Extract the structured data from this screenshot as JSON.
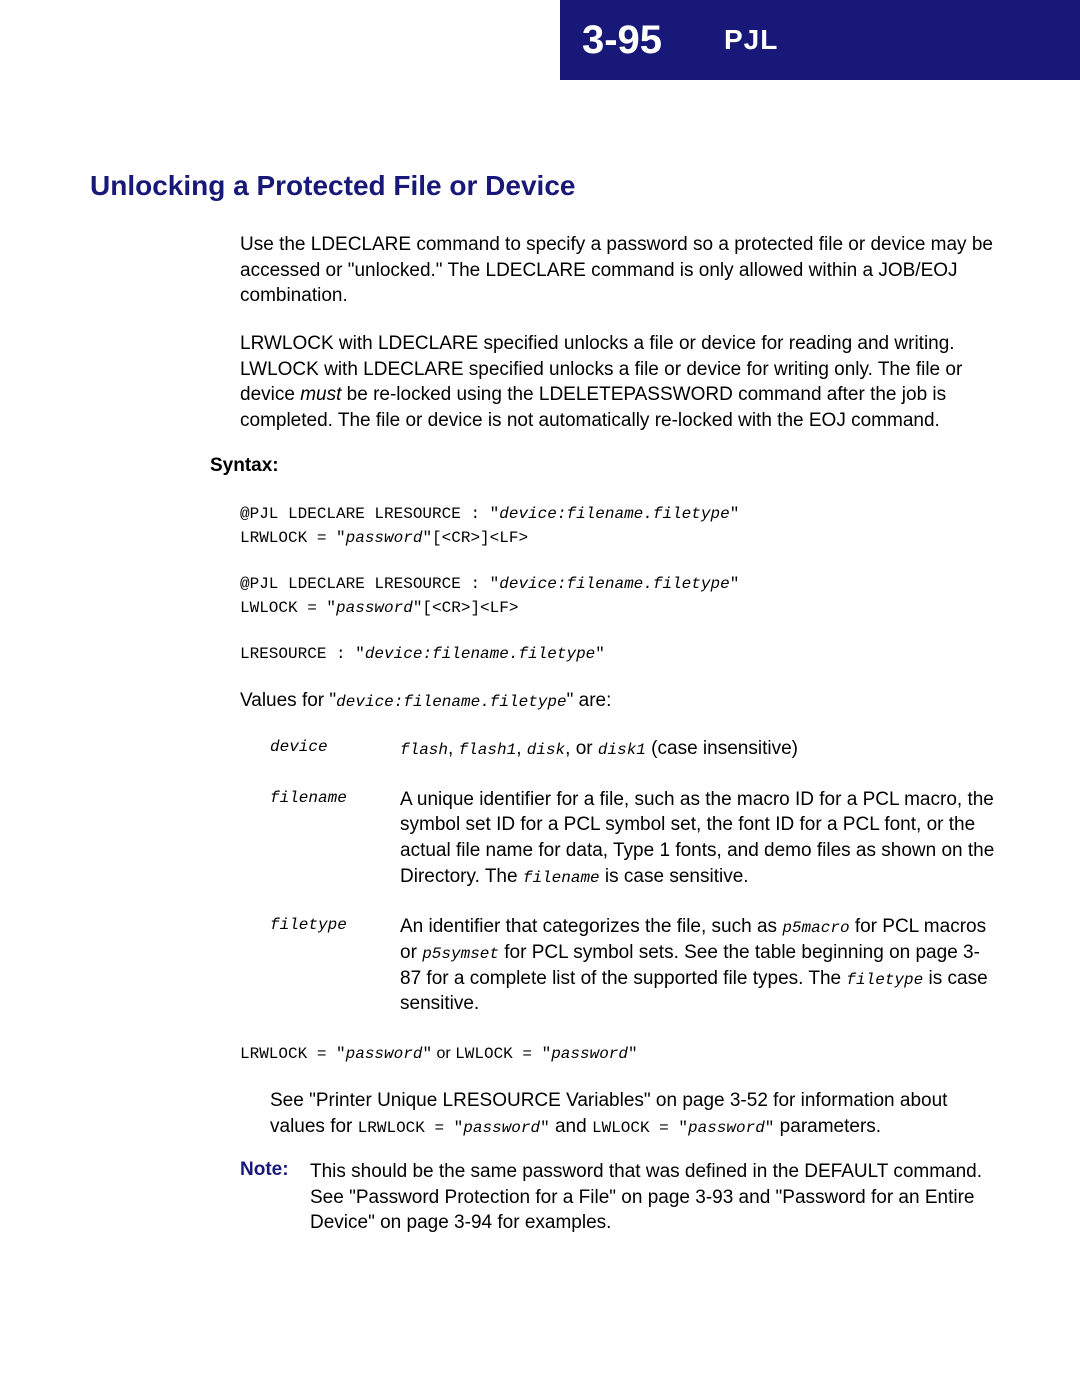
{
  "header": {
    "page": "3-95",
    "chapter": "PJL"
  },
  "title": "Unlocking a Protected File or Device",
  "para1": "Use the LDECLARE command to specify a password so a protected file or device may be accessed or \"unlocked.\" The LDECLARE command is only allowed within a JOB/EOJ combination.",
  "para2_a": "LRWLOCK with LDECLARE specified unlocks a file or device for reading and writing. LWLOCK with LDECLARE specified unlocks a file or device for writing only. The file or device ",
  "para2_must": "must",
  "para2_b": " be re-locked using the LDELETEPASSWORD command after the job is completed. The file or device is not automatically re-locked with the EOJ command.",
  "syntax_label": "Syntax:",
  "code1_a": "@PJL LDECLARE LRESOURCE : \"",
  "code1_dev": "device:filename.filetype",
  "code1_b": "\"\nLRWLOCK = \"",
  "code1_pw": "password",
  "code1_c": "\"[<CR>]<LF>",
  "code2_a": "@PJL LDECLARE LRESOURCE : \"",
  "code2_dev": "device:filename.filetype",
  "code2_b": "\"\nLWLOCK = \"",
  "code2_pw": "password",
  "code2_c": "\"[<CR>]<LF>",
  "code3_a": "LRESOURCE : \"",
  "code3_dev": "device:filename.filetype",
  "code3_b": "\"",
  "values_a": "Values for \"",
  "values_dev": "device:filename.filetype",
  "values_b": "\" are:",
  "def_device_term": "device",
  "def_device_flash": "flash",
  "def_device_c1": ", ",
  "def_device_flash1": "flash1",
  "def_device_c2": ", ",
  "def_device_disk": "disk",
  "def_device_or": ", or ",
  "def_device_disk1": "disk1",
  "def_device_tail": " (case insensitive)",
  "def_filename_term": "filename",
  "def_filename_a": "A unique identifier for a file, such as the macro ID for a PCL macro, the symbol set ID for a PCL symbol set, the font ID for a PCL font, or the actual file name for data, Type 1 fonts, and demo files as shown on the Directory. The ",
  "def_filename_code": "filename",
  "def_filename_b": " is case sensitive.",
  "def_filetype_term": "filetype",
  "def_filetype_a": "An identifier that categorizes the file, such as ",
  "def_filetype_p5macro": "p5macro",
  "def_filetype_b": " for PCL macros or ",
  "def_filetype_p5symset": "p5symset",
  "def_filetype_c": " for PCL symbol sets. See the table beginning on page 3-87 for a complete list of the supported file types. The ",
  "def_filetype_code": "filetype",
  "def_filetype_d": " is case sensitive.",
  "lock_a": "LRWLOCK = \"",
  "lock_pw1": "password",
  "lock_b": "\"",
  "lock_or": " or ",
  "lock_c": "LWLOCK = \"",
  "lock_pw2": "password",
  "lock_d": "\"",
  "see_a": "See \"Printer Unique LRESOURCE Variables\" on page 3-52 for information about values for ",
  "see_code1": "LRWLOCK = \"",
  "see_pw1": "password",
  "see_code1b": "\"",
  "see_and": " and ",
  "see_code2": "LWLOCK = \"",
  "see_pw2": "password",
  "see_code2b": "\"",
  "see_tail": " parameters.",
  "note_label": "Note:",
  "note_body": "This should be the same password that was defined in the DEFAULT command. See \"Password Protection for a File\" on page 3-93 and \"Password for an Entire Device\" on page 3-94 for examples."
}
